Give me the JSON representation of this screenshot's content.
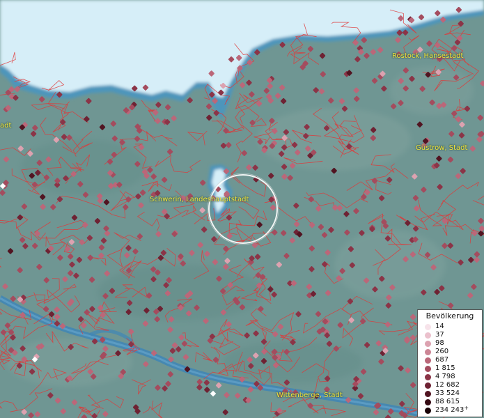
{
  "legend": {
    "title": "Bevölkerung",
    "items": [
      {
        "label": "14",
        "color": "#f7e3ea"
      },
      {
        "label": "37",
        "color": "#ebc1cd"
      },
      {
        "label": "98",
        "color": "#dca2b0"
      },
      {
        "label": "260",
        "color": "#cc8595"
      },
      {
        "label": "687",
        "color": "#bb6779"
      },
      {
        "label": "1 815",
        "color": "#a44c5e"
      },
      {
        "label": "4 798",
        "color": "#8b3447"
      },
      {
        "label": "12 682",
        "color": "#6e2233"
      },
      {
        "label": "33 524",
        "color": "#511421"
      },
      {
        "label": "88 615",
        "color": "#350a13"
      },
      {
        "label": "234 243",
        "color": "#1a0308"
      }
    ],
    "plus": "+"
  },
  "cities": [
    {
      "name": "Rostock, Hansestadt"
    },
    {
      "name": "Güstrow, Stadt"
    },
    {
      "name": "Schwerin, Landeshauptstadt"
    },
    {
      "name": "Wittenberge, Stadt"
    },
    {
      "name": "adt"
    }
  ],
  "colors": {
    "land": "#6f9693",
    "sea": "#d6eef8",
    "water": "#3f86b6",
    "border": "#e03838"
  }
}
